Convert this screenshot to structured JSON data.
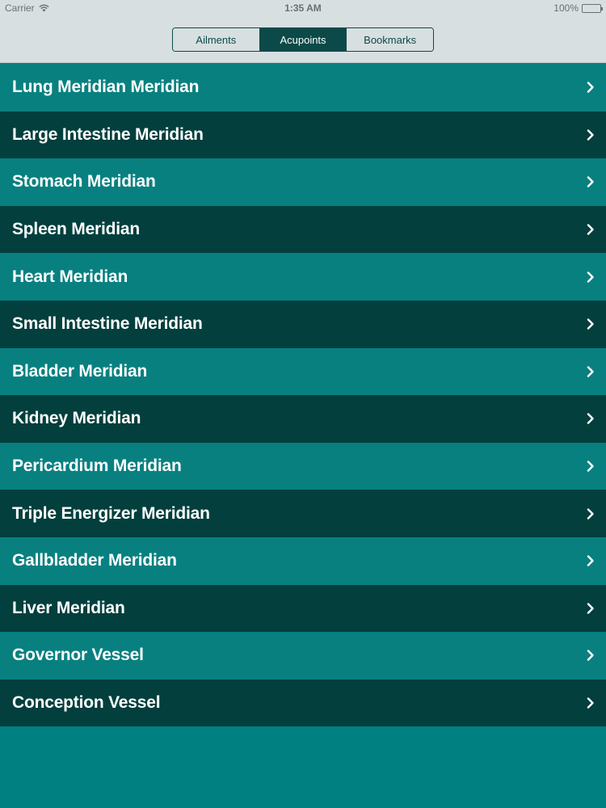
{
  "status_bar": {
    "carrier": "Carrier",
    "time": "1:35 AM",
    "battery": "100%"
  },
  "segments": [
    {
      "label": "Ailments",
      "active": false
    },
    {
      "label": "Acupoints",
      "active": true
    },
    {
      "label": "Bookmarks",
      "active": false
    }
  ],
  "list": [
    {
      "label": "Lung Meridian Meridian"
    },
    {
      "label": "Large Intestine Meridian"
    },
    {
      "label": "Stomach Meridian"
    },
    {
      "label": "Spleen Meridian"
    },
    {
      "label": "Heart Meridian"
    },
    {
      "label": "Small Intestine Meridian"
    },
    {
      "label": "Bladder Meridian"
    },
    {
      "label": "Kidney Meridian"
    },
    {
      "label": "Pericardium Meridian"
    },
    {
      "label": "Triple Energizer Meridian"
    },
    {
      "label": "Gallbladder Meridian"
    },
    {
      "label": "Liver Meridian"
    },
    {
      "label": "Governor Vessel"
    },
    {
      "label": "Conception Vessel"
    }
  ],
  "colors": {
    "row_light": "#088080",
    "row_dark": "#023f3d",
    "background": "#008080",
    "nav_background": "#d8dfe1",
    "accent": "#0b4a48"
  }
}
